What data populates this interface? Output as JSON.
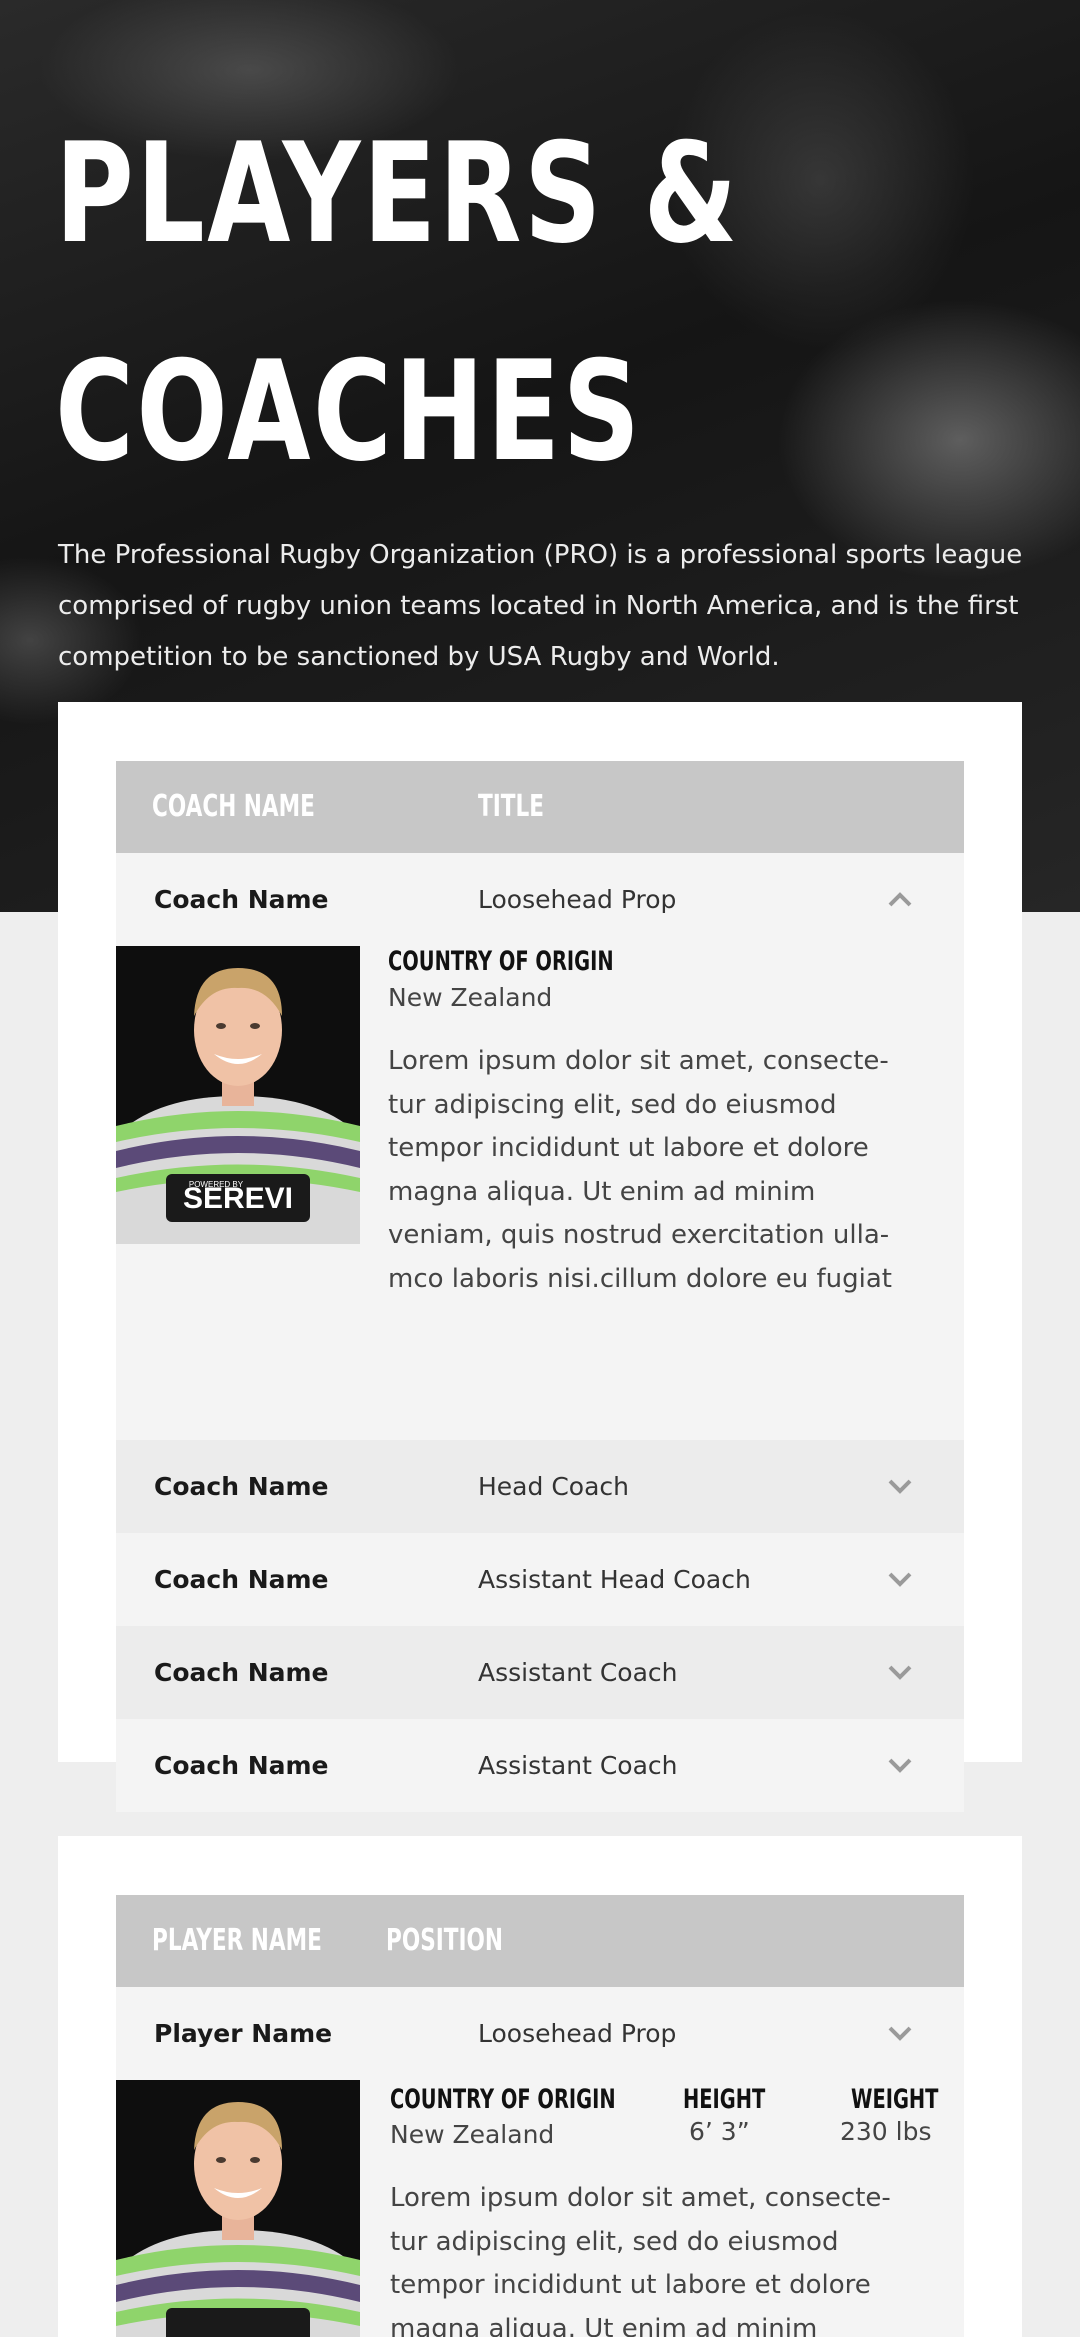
{
  "hero": {
    "title_line1": "PLAYERS &",
    "title_line2": "COACHES",
    "intro_line1": "The Professional Rugby Organization (PRO) is a professional sports league",
    "intro_line2": "comprised of rugby union teams located in North America, and is the first",
    "intro_line3": "competition to be sanctioned by USA Rugby and World."
  },
  "coaches": {
    "header": {
      "col1": "COACH NAME",
      "col2": "TITLE"
    },
    "expanded": {
      "name": "Coach Name",
      "title": "Loosehead Prop",
      "country_label": "COUNTRY OF ORIGIN",
      "country_value": "New Zealand",
      "jersey_text": "SEREVI",
      "jersey_small": "POWERED BY",
      "bio_lines": [
        "Lorem ipsum dolor sit amet, consecte-",
        "tur adipiscing elit, sed do eiusmod",
        "tempor incididunt ut labore et dolore",
        "magna aliqua. Ut enim ad minim",
        "veniam, quis nostrud exercitation ulla-",
        "mco laboris nisi.cillum dolore eu fugiat"
      ]
    },
    "rows": [
      {
        "name": "Coach Name",
        "title": "Head Coach"
      },
      {
        "name": "Coach Name",
        "title": "Assistant Head Coach"
      },
      {
        "name": "Coach Name",
        "title": "Assistant Coach"
      },
      {
        "name": "Coach Name",
        "title": "Assistant Coach"
      }
    ]
  },
  "players": {
    "header": {
      "col1": "PLAYER NAME",
      "col2": "POSITION"
    },
    "expanded": {
      "name": "Player Name",
      "position": "Loosehead Prop",
      "country_label": "COUNTRY OF ORIGIN",
      "country_value": "New Zealand",
      "height_label": "HEIGHT",
      "height_value": "6’ 3”",
      "weight_label": "WEIGHT",
      "weight_value": "230 lbs",
      "bio_lines": [
        "Lorem ipsum dolor sit amet, consecte-",
        "tur adipiscing elit, sed do eiusmod",
        "tempor incididunt ut labore et dolore",
        "magna aliqua. Ut enim ad minim"
      ]
    }
  },
  "colors": {
    "header_bg": "#c7c7c7",
    "row_bg": "#f4f4f4",
    "row_alt_bg": "#ececec",
    "chevron": "#9a9a9a"
  }
}
